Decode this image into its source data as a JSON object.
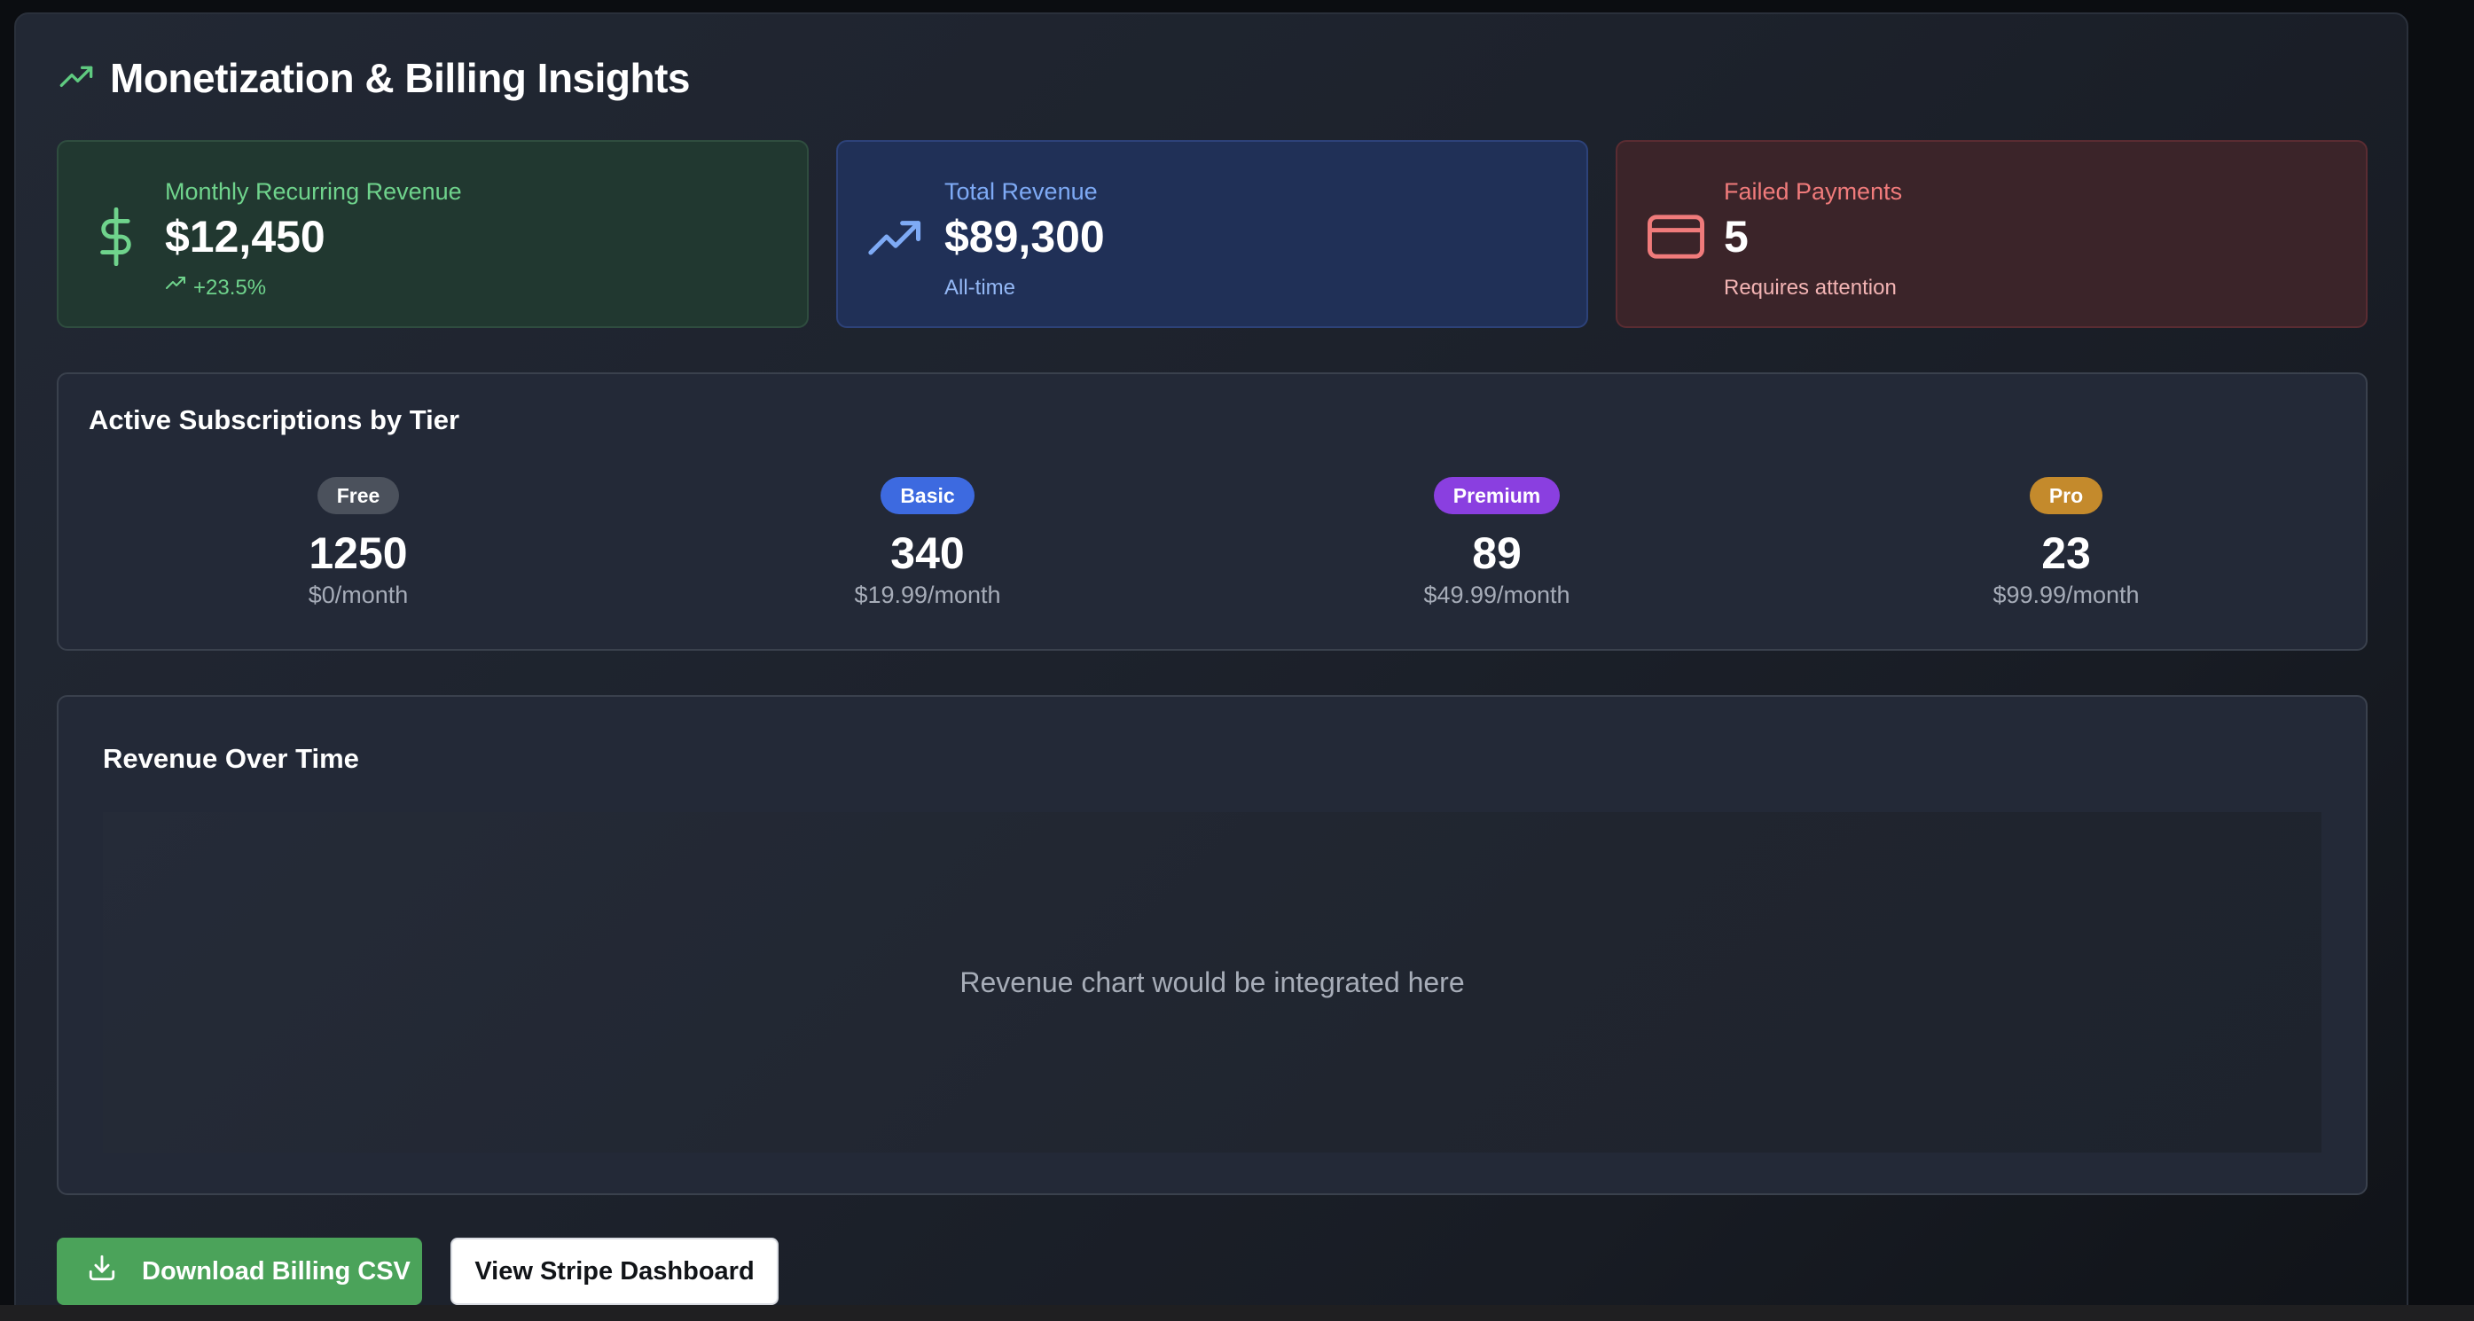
{
  "header": {
    "title": "Monetization & Billing Insights",
    "icon": "trending-up-icon"
  },
  "stats": [
    {
      "label": "Monthly Recurring Revenue",
      "value": "$12,450",
      "sub": "+23.5%",
      "icon": "dollar-icon",
      "accent": "#6fd38c"
    },
    {
      "label": "Total Revenue",
      "value": "$89,300",
      "sub": "All-time",
      "icon": "trending-up-icon",
      "accent": "#7eaaf5"
    },
    {
      "label": "Failed Payments",
      "value": "5",
      "sub": "Requires attention",
      "icon": "credit-card-icon",
      "accent": "#f07b7b"
    }
  ],
  "subscriptions": {
    "title": "Active Subscriptions by Tier",
    "tiers": [
      {
        "name": "Free",
        "count": "1250",
        "price": "$0/month",
        "color": "#4b515c"
      },
      {
        "name": "Basic",
        "count": "340",
        "price": "$19.99/month",
        "color": "#3d6ae0"
      },
      {
        "name": "Premium",
        "count": "89",
        "price": "$49.99/month",
        "color": "#8a3fe0"
      },
      {
        "name": "Pro",
        "count": "23",
        "price": "$99.99/month",
        "color": "#c48a2c"
      }
    ]
  },
  "revenue_chart": {
    "title": "Revenue Over Time",
    "placeholder": "Revenue chart would be integrated here"
  },
  "actions": {
    "download_label": "Download Billing CSV",
    "stripe_label": "View Stripe Dashboard"
  }
}
